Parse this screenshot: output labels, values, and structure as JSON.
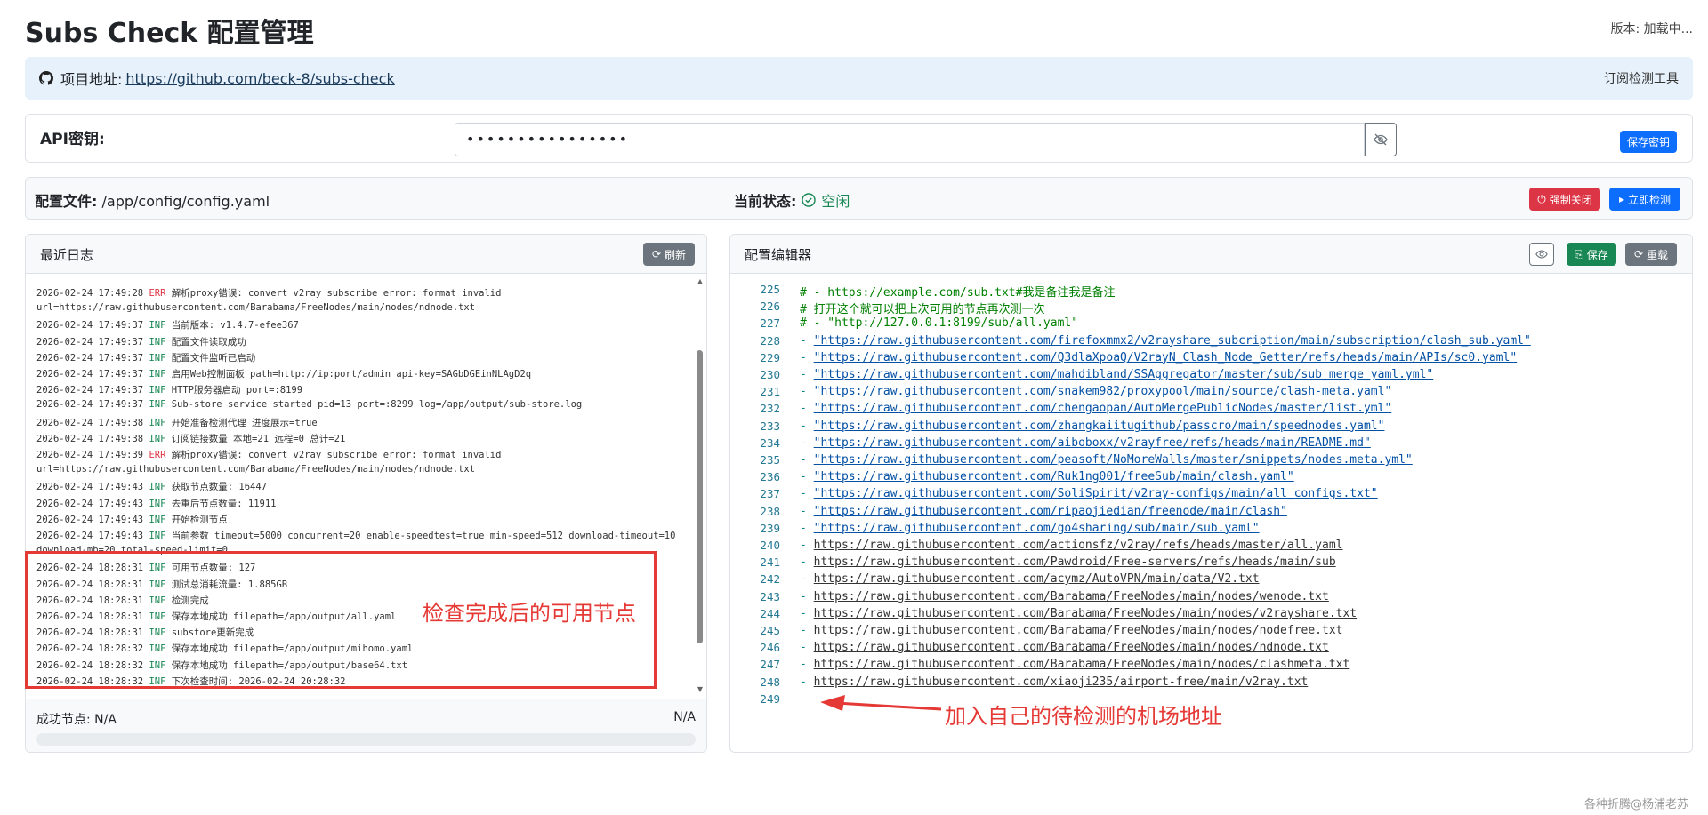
{
  "header": {
    "title": "Subs Check 配置管理",
    "version": "版本: 加载中..."
  },
  "repo": {
    "label": "项目地址:",
    "url": "https://github.com/beck-8/subs-check",
    "right": "订阅检测工具"
  },
  "api": {
    "label": "API密钥:",
    "value": "••••••••••••••••",
    "save": "保存密钥"
  },
  "config": {
    "file_label": "配置文件:",
    "file_path": "/app/config/config.yaml",
    "status_label": "当前状态:",
    "status_value": "空闲",
    "force_close": "强制关闭",
    "check_now": "立即检测"
  },
  "logs": {
    "title": "最近日志",
    "refresh": "刷新",
    "lines": [
      {
        "t": "2026-02-24 17:49:28",
        "lvl": "ERR",
        "msg": "解析proxy错误: convert v2ray subscribe error: format invalid"
      },
      {
        "t": "",
        "lvl": "",
        "msg": "url=https://raw.githubusercontent.com/Barabama/FreeNodes/main/nodes/ndnode.txt"
      },
      {
        "t": "2026-02-24 17:49:37",
        "lvl": "INF",
        "msg": "当前版本: v1.4.7-efee367"
      },
      {
        "t": "2026-02-24 17:49:37",
        "lvl": "INF",
        "msg": "配置文件读取成功"
      },
      {
        "t": "2026-02-24 17:49:37",
        "lvl": "INF",
        "msg": "配置文件监听已启动"
      },
      {
        "t": "2026-02-24 17:49:37",
        "lvl": "INF",
        "msg": "启用Web控制面板 path=http://ip:port/admin api-key=SAGbDGEinNLAgD2q"
      },
      {
        "t": "2026-02-24 17:49:37",
        "lvl": "INF",
        "msg": "HTTP服务器启动 port=:8199"
      },
      {
        "t": "2026-02-24 17:49:37",
        "lvl": "INF",
        "msg": "Sub-store service started pid=13 port=:8299 log=/app/output/sub-store.log"
      },
      {
        "t": "2026-02-24 17:49:38",
        "lvl": "INF",
        "msg": "开始准备检测代理 进度展示=true"
      },
      {
        "t": "2026-02-24 17:49:38",
        "lvl": "INF",
        "msg": "订阅链接数量 本地=21 远程=0 总计=21"
      },
      {
        "t": "2026-02-24 17:49:39",
        "lvl": "ERR",
        "msg": "解析proxy错误: convert v2ray subscribe error: format invalid"
      },
      {
        "t": "",
        "lvl": "",
        "msg": "url=https://raw.githubusercontent.com/Barabama/FreeNodes/main/nodes/ndnode.txt"
      },
      {
        "t": "2026-02-24 17:49:43",
        "lvl": "INF",
        "msg": "获取节点数量: 16447"
      },
      {
        "t": "2026-02-24 17:49:43",
        "lvl": "INF",
        "msg": "去重后节点数量: 11911"
      },
      {
        "t": "2026-02-24 17:49:43",
        "lvl": "INF",
        "msg": "开始检测节点"
      },
      {
        "t": "2026-02-24 17:49:43",
        "lvl": "INF",
        "msg": "当前参数 timeout=5000 concurrent=20 enable-speedtest=true min-speed=512 download-timeout=10"
      },
      {
        "t": "",
        "lvl": "",
        "msg": "download-mb=20 total-speed-limit=0"
      },
      {
        "t": "2026-02-24 18:28:31",
        "lvl": "INF",
        "msg": "可用节点数量: 127"
      },
      {
        "t": "2026-02-24 18:28:31",
        "lvl": "INF",
        "msg": "测试总消耗流量: 1.885GB"
      },
      {
        "t": "2026-02-24 18:28:31",
        "lvl": "INF",
        "msg": "检测完成"
      },
      {
        "t": "2026-02-24 18:28:31",
        "lvl": "INF",
        "msg": "保存本地成功 filepath=/app/output/all.yaml"
      },
      {
        "t": "2026-02-24 18:28:31",
        "lvl": "INF",
        "msg": "substore更新完成"
      },
      {
        "t": "2026-02-24 18:28:32",
        "lvl": "INF",
        "msg": "保存本地成功 filepath=/app/output/mihomo.yaml"
      },
      {
        "t": "2026-02-24 18:28:32",
        "lvl": "INF",
        "msg": "保存本地成功 filepath=/app/output/base64.txt"
      },
      {
        "t": "2026-02-24 18:28:32",
        "lvl": "INF",
        "msg": "下次检查时间: 2026-02-24 20:28:32"
      }
    ],
    "success_label": "成功节点: N/A",
    "success_right": "N/A"
  },
  "editor": {
    "title": "配置编辑器",
    "save": "保存",
    "reload": "重载",
    "lines": [
      {
        "n": "225",
        "kind": "comment",
        "text": "# - https://example.com/sub.txt#我是备注我是备注"
      },
      {
        "n": "226",
        "kind": "comment",
        "text": "# 打开这个就可以把上次可用的节点再次测一次"
      },
      {
        "n": "227",
        "kind": "comment",
        "text": "# - \"http://127.0.0.1:8199/sub/all.yaml\""
      },
      {
        "n": "228",
        "kind": "quoted",
        "text": "https://raw.githubusercontent.com/firefoxmmx2/v2rayshare_subcription/main/subscription/clash_sub.yaml"
      },
      {
        "n": "229",
        "kind": "quoted",
        "text": "https://raw.githubusercontent.com/Q3dlaXpoaQ/V2rayN_Clash_Node_Getter/refs/heads/main/APIs/sc0.yaml"
      },
      {
        "n": "230",
        "kind": "quoted",
        "text": "https://raw.githubusercontent.com/mahdibland/SSAggregator/master/sub/sub_merge_yaml.yml"
      },
      {
        "n": "231",
        "kind": "quoted",
        "text": "https://raw.githubusercontent.com/snakem982/proxypool/main/source/clash-meta.yaml"
      },
      {
        "n": "232",
        "kind": "quoted",
        "text": "https://raw.githubusercontent.com/chengaopan/AutoMergePublicNodes/master/list.yml"
      },
      {
        "n": "233",
        "kind": "quoted",
        "text": "https://raw.githubusercontent.com/zhangkaiitugithub/passcro/main/speednodes.yaml"
      },
      {
        "n": "234",
        "kind": "quoted",
        "text": "https://raw.githubusercontent.com/aiboboxx/v2rayfree/refs/heads/main/README.md"
      },
      {
        "n": "235",
        "kind": "quoted",
        "text": "https://raw.githubusercontent.com/peasoft/NoMoreWalls/master/snippets/nodes.meta.yml"
      },
      {
        "n": "236",
        "kind": "quoted",
        "text": "https://raw.githubusercontent.com/Ruk1ng001/freeSub/main/clash.yaml"
      },
      {
        "n": "237",
        "kind": "quoted",
        "text": "https://raw.githubusercontent.com/SoliSpirit/v2ray-configs/main/all_configs.txt"
      },
      {
        "n": "238",
        "kind": "quoted",
        "text": "https://raw.githubusercontent.com/ripaojiedian/freenode/main/clash"
      },
      {
        "n": "239",
        "kind": "quoted",
        "text": "https://raw.githubusercontent.com/go4sharing/sub/main/sub.yaml"
      },
      {
        "n": "240",
        "kind": "plain",
        "text": "https://raw.githubusercontent.com/actionsfz/v2ray/refs/heads/master/all.yaml"
      },
      {
        "n": "241",
        "kind": "plain",
        "text": "https://raw.githubusercontent.com/Pawdroid/Free-servers/refs/heads/main/sub"
      },
      {
        "n": "242",
        "kind": "plain",
        "text": "https://raw.githubusercontent.com/acymz/AutoVPN/main/data/V2.txt"
      },
      {
        "n": "243",
        "kind": "plain",
        "text": "https://raw.githubusercontent.com/Barabama/FreeNodes/main/nodes/wenode.txt"
      },
      {
        "n": "244",
        "kind": "plain",
        "text": "https://raw.githubusercontent.com/Barabama/FreeNodes/main/nodes/v2rayshare.txt"
      },
      {
        "n": "245",
        "kind": "plain",
        "text": "https://raw.githubusercontent.com/Barabama/FreeNodes/main/nodes/nodefree.txt"
      },
      {
        "n": "246",
        "kind": "plain",
        "text": "https://raw.githubusercontent.com/Barabama/FreeNodes/main/nodes/ndnode.txt"
      },
      {
        "n": "247",
        "kind": "plain",
        "text": "https://raw.githubusercontent.com/Barabama/FreeNodes/main/nodes/clashmeta.txt"
      },
      {
        "n": "248",
        "kind": "plain",
        "text": "https://raw.githubusercontent.com/xiaoji235/airport-free/main/v2ray.txt"
      },
      {
        "n": "249",
        "kind": "empty",
        "text": ""
      }
    ]
  },
  "annotations": {
    "left": "检查完成后的可用节点",
    "right": "加入自己的待检测的机场地址"
  },
  "watermark": "各种折腾@杨浦老苏",
  "colors": {
    "primary": "#0d6efd",
    "danger": "#dc3545",
    "success": "#198754",
    "annot": "#e53935"
  }
}
